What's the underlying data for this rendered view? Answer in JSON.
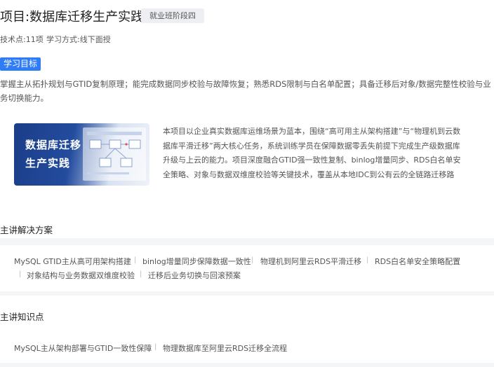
{
  "project": {
    "title": "项目:数据库迁移生产实践",
    "tag": "就业班阶段四",
    "meta_points": "技术点:11项",
    "meta_mode": "学习方式:线下面授"
  },
  "goal": {
    "badge": "学习目标",
    "text": "掌握主从拓扑规划与GTID复制原理；能完成数据同步校验与故障恢复；熟悉RDS限制与白名单配置；具备迁移后对象/数据完整性校验与业务切换能力。"
  },
  "thumbnail": {
    "line1": "数据库迁移",
    "line2": "生产实践"
  },
  "description": "本项目以企业真实数据库运维场景为蓝本，围绕“高可用主从架构搭建”与“物理机到云数据库平滑迁移”两大核心任务，系统训练学员在保障数据零丢失前提下完成生产级数据库升级与上云的能力。项目深度融合GTID强一致性复制、binlog增量同步、RDS白名单安全策略、对象与数据双维度校验等关键技术，覆盖从本地IDC到公有云的全链路迁移路径，是《DBA数…",
  "solutions": {
    "title": "主讲解决方案",
    "items": [
      "MySQL GTID主从高可用架构搭建",
      "binlog增量同步保障数据一致性",
      "物理机到阿里云RDS平滑迁移",
      "RDS白名单安全策略配置",
      "对象结构与业务数据双维度校验",
      "迁移后业务切换与回滚预案"
    ],
    "separator": "|"
  },
  "knowledge": {
    "title": "主讲知识点",
    "items": [
      "MySQL主从架构部署与GTID一致性保障",
      "物理数据库至阿里云RDS迁移全流程"
    ],
    "separator": "|"
  },
  "colors": {
    "accent": "#2f7df6",
    "thumb_dark": "#1b3d88"
  }
}
